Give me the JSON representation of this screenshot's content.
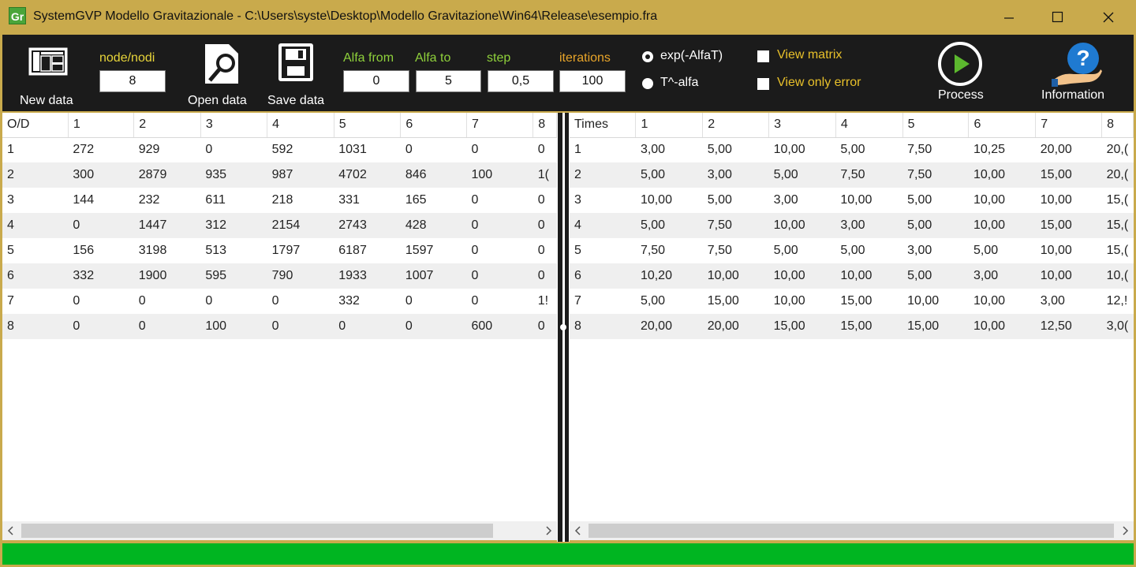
{
  "window": {
    "title": "SystemGVP Modello Gravitazionale - C:\\Users\\syste\\Desktop\\Modello Gravitazione\\Win64\\Release\\esempio.fra",
    "icon_text": "Gr",
    "controls": [
      "minimize-icon",
      "maximize-icon",
      "close-icon"
    ]
  },
  "toolbar": {
    "new_data_label": "New data",
    "open_data_label": "Open data",
    "save_data_label": "Save data",
    "nodes_caption": "node/nodi",
    "nodes_value": "8",
    "alfa_from_caption": "Alfa from",
    "alfa_from_value": "0",
    "alfa_to_caption": "Alfa to",
    "alfa_to_value": "5",
    "step_caption": "step",
    "step_value": "0,5",
    "iterations_caption": "iterations",
    "iterations_value": "100",
    "radio_exp_label": "exp(-AlfaT)",
    "radio_exp_checked": true,
    "radio_talfa_label": "T^-alfa",
    "radio_talfa_checked": false,
    "view_matrix_label": "View matrix",
    "view_only_error_label": "View only error",
    "process_label": "Process",
    "information_label": "Information",
    "colors": {
      "green_caption": "#8fd13b",
      "yellow_caption": "#e8d53a",
      "orange_caption": "#e8a52a",
      "check_label": "#e8c02a",
      "toolbar_bg": "#1b1b1b",
      "status_green": "#00b521",
      "frame_gold": "#c9aa4c"
    }
  },
  "od_grid": {
    "headers": [
      "O/D",
      "1",
      "2",
      "3",
      "4",
      "5",
      "6",
      "7",
      "8"
    ],
    "rows": [
      [
        "1",
        "272",
        "929",
        "0",
        "592",
        "1031",
        "0",
        "0",
        "0"
      ],
      [
        "2",
        "300",
        "2879",
        "935",
        "987",
        "4702",
        "846",
        "100",
        "1("
      ],
      [
        "3",
        "144",
        "232",
        "611",
        "218",
        "331",
        "165",
        "0",
        "0"
      ],
      [
        "4",
        "0",
        "1447",
        "312",
        "2154",
        "2743",
        "428",
        "0",
        "0"
      ],
      [
        "5",
        "156",
        "3198",
        "513",
        "1797",
        "6187",
        "1597",
        "0",
        "0"
      ],
      [
        "6",
        "332",
        "1900",
        "595",
        "790",
        "1933",
        "1007",
        "0",
        "0"
      ],
      [
        "7",
        "0",
        "0",
        "0",
        "0",
        "332",
        "0",
        "0",
        "1!"
      ],
      [
        "8",
        "0",
        "0",
        "100",
        "0",
        "0",
        "0",
        "600",
        "0"
      ]
    ]
  },
  "times_grid": {
    "headers": [
      "Times",
      "1",
      "2",
      "3",
      "4",
      "5",
      "6",
      "7",
      "8"
    ],
    "rows": [
      [
        "1",
        "3,00",
        "5,00",
        "10,00",
        "5,00",
        "7,50",
        "10,25",
        "20,00",
        "20,("
      ],
      [
        "2",
        "5,00",
        "3,00",
        "5,00",
        "7,50",
        "7,50",
        "10,00",
        "15,00",
        "20,("
      ],
      [
        "3",
        "10,00",
        "5,00",
        "3,00",
        "10,00",
        "5,00",
        "10,00",
        "10,00",
        "15,("
      ],
      [
        "4",
        "5,00",
        "7,50",
        "10,00",
        "3,00",
        "5,00",
        "10,00",
        "15,00",
        "15,("
      ],
      [
        "5",
        "7,50",
        "7,50",
        "5,00",
        "5,00",
        "3,00",
        "5,00",
        "10,00",
        "15,("
      ],
      [
        "6",
        "10,20",
        "10,00",
        "10,00",
        "10,00",
        "5,00",
        "3,00",
        "10,00",
        "10,("
      ],
      [
        "7",
        "5,00",
        "15,00",
        "10,00",
        "15,00",
        "10,00",
        "10,00",
        "3,00",
        "12,!"
      ],
      [
        "8",
        "20,00",
        "20,00",
        "15,00",
        "15,00",
        "15,00",
        "10,00",
        "12,50",
        "3,0("
      ]
    ]
  }
}
